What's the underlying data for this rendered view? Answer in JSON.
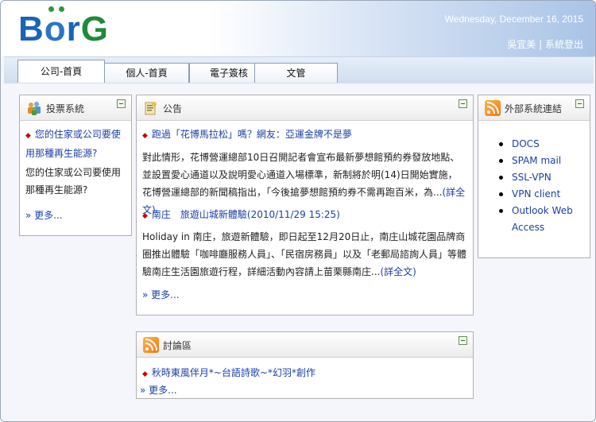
{
  "header": {
    "logo": {
      "b": "B",
      "o": "o",
      "r": "r",
      "g": "G"
    },
    "date": "Wednesday, December 16, 2015",
    "user_name": "吳宜美",
    "separator": " | ",
    "logout": "系統登出"
  },
  "tabs": [
    {
      "label": "公司-首頁",
      "active": true
    },
    {
      "label": "個人-首頁",
      "active": false
    },
    {
      "label": "電子簽核",
      "active": false
    },
    {
      "label": "文管",
      "active": false
    }
  ],
  "vote": {
    "title": "投票系統",
    "link": "您的住家或公司要使用那種再生能源?",
    "text": "您的住家或公司要使用那種再生能源?",
    "more": "» 更多..."
  },
  "announce": {
    "title": "公告",
    "items": [
      {
        "title": "跑過「花博馬拉松」嗎？網友：亞運金牌不是夢",
        "body": "對此情形，花博營運總部10日召開記者會宣布最新夢想館預約券發放地點、並設置愛心通道以及說明愛心通道入場標準，新制將於明(14)日開始實施，花博營運總部的新聞稿指出，「今後搶夢想館預約券不需再跑百米，為...",
        "full": "(詳全文)"
      },
      {
        "title": "南庄　旅遊山城新體驗(2010/11/29 15:25)",
        "body": "Holiday in 南庄，旅遊新體驗，即日起至12月20日止，南庄山城花園品牌商圈推出體驗「咖啡廳服務人員」、「民宿房務員」以及「老郵局諮詢人員」等體驗南庄生活園旅遊行程，詳細活動內容請上苗栗縣南庄...",
        "full": "(詳全文)"
      }
    ],
    "more": "» 更多..."
  },
  "discuss": {
    "title": "討論區",
    "item": "秋時東風伴月*~台語詩歌~*幻羽*創作",
    "more": "» 更多..."
  },
  "external": {
    "title": "外部系統連結",
    "links": [
      "DOCS",
      "SPAM mail",
      "SSL-VPN",
      "VPN client",
      "Outlook Web Access"
    ]
  },
  "colors": {
    "accent": "#1a63b8",
    "link": "#1a3fa8",
    "logo_green": "#1f8a3a"
  }
}
